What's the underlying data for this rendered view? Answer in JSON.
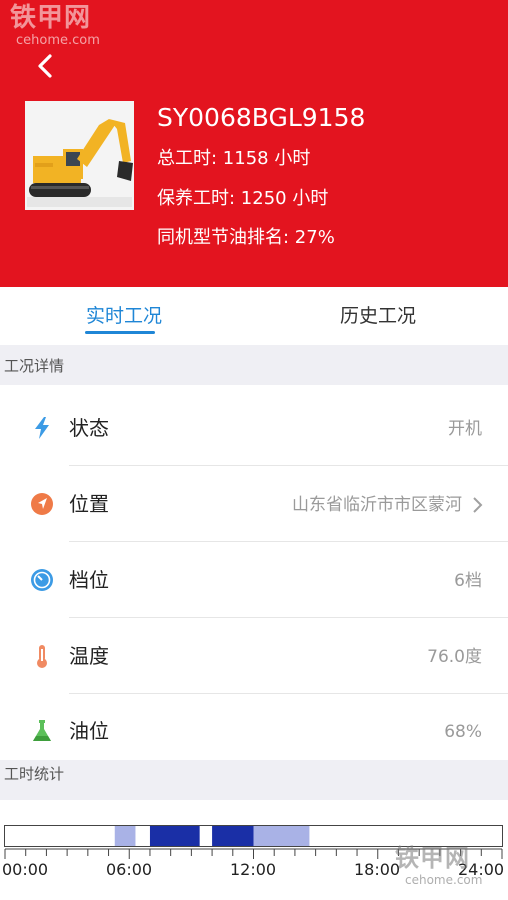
{
  "watermark": {
    "cn": "铁甲网",
    "en": "cehome.com"
  },
  "header": {
    "machine_id": "SY0068BGL9158",
    "total_hours": "总工时: 1158 小时",
    "maintenance_hours": "保养工时: 1250 小时",
    "fuel_rank": "同机型节油排名: 27%"
  },
  "tabs": [
    {
      "label": "实时工况",
      "active": true
    },
    {
      "label": "历史工况",
      "active": false
    }
  ],
  "section_details": "工况详情",
  "rows": [
    {
      "label": "状态",
      "value": "开机",
      "icon": "lightning-icon"
    },
    {
      "label": "位置",
      "value": "山东省临沂市市区蒙河",
      "icon": "location-arrow-icon"
    },
    {
      "label": "档位",
      "value": "6档",
      "icon": "gauge-icon"
    },
    {
      "label": "温度",
      "value": "76.0度",
      "icon": "thermometer-icon"
    },
    {
      "label": "油位",
      "value": "68%",
      "icon": "flask-icon"
    }
  ],
  "section_hours": "工时统计",
  "timeline": {
    "tick_labels": [
      "00:00",
      "06:00",
      "12:00",
      "18:00",
      "24:00"
    ],
    "segments": [
      {
        "start": 5.3,
        "end": 6.3,
        "level": "light"
      },
      {
        "start": 7.0,
        "end": 9.4,
        "level": "dark"
      },
      {
        "start": 10.0,
        "end": 12.0,
        "level": "dark"
      },
      {
        "start": 12.0,
        "end": 14.7,
        "level": "light"
      }
    ],
    "colors": {
      "dark": "#1a2fa6",
      "light": "#a9b2e6"
    }
  }
}
